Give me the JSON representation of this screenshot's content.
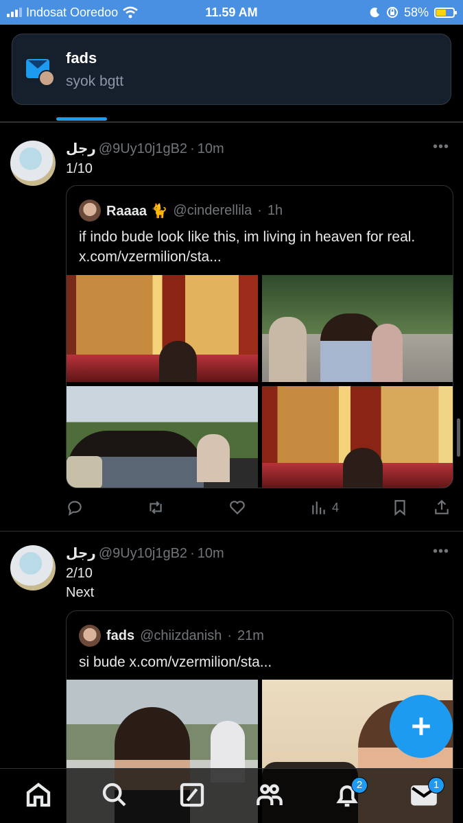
{
  "status_bar": {
    "carrier": "Indosat Ooredoo",
    "time": "11.59 AM",
    "battery_percent": "58%",
    "battery_level": 0.58
  },
  "notification": {
    "title": "fads",
    "body": "syok bgtt",
    "icon": "envelope-icon"
  },
  "tweets": [
    {
      "display_name": "رجل",
      "handle": "@9Uy10j1gB2",
      "dot": "·",
      "time": "10m",
      "text": "1/10",
      "quote": {
        "display_name": "Raaaa 🐈",
        "handle": "@cinderellila",
        "dot": "·",
        "time": "1h",
        "text": "if indo bude look like this, im living in heaven for real. x.com/vzermilion/sta..."
      },
      "actions": {
        "reply": "",
        "retweet": "",
        "like": "",
        "views": "4"
      }
    },
    {
      "display_name": "رجل",
      "handle": "@9Uy10j1gB2",
      "dot": "·",
      "time": "10m",
      "text": "2/10\nNext",
      "quote": {
        "display_name": "fads",
        "handle": "@chiizdanish",
        "dot": "·",
        "time": "21m",
        "text": "si bude x.com/vzermilion/sta..."
      }
    }
  ],
  "bottom_nav": {
    "notifications_badge": "2",
    "messages_badge": "1"
  },
  "colors": {
    "accent": "#1d9bf0",
    "status_bar": "#4a90e2",
    "background": "#000000"
  }
}
